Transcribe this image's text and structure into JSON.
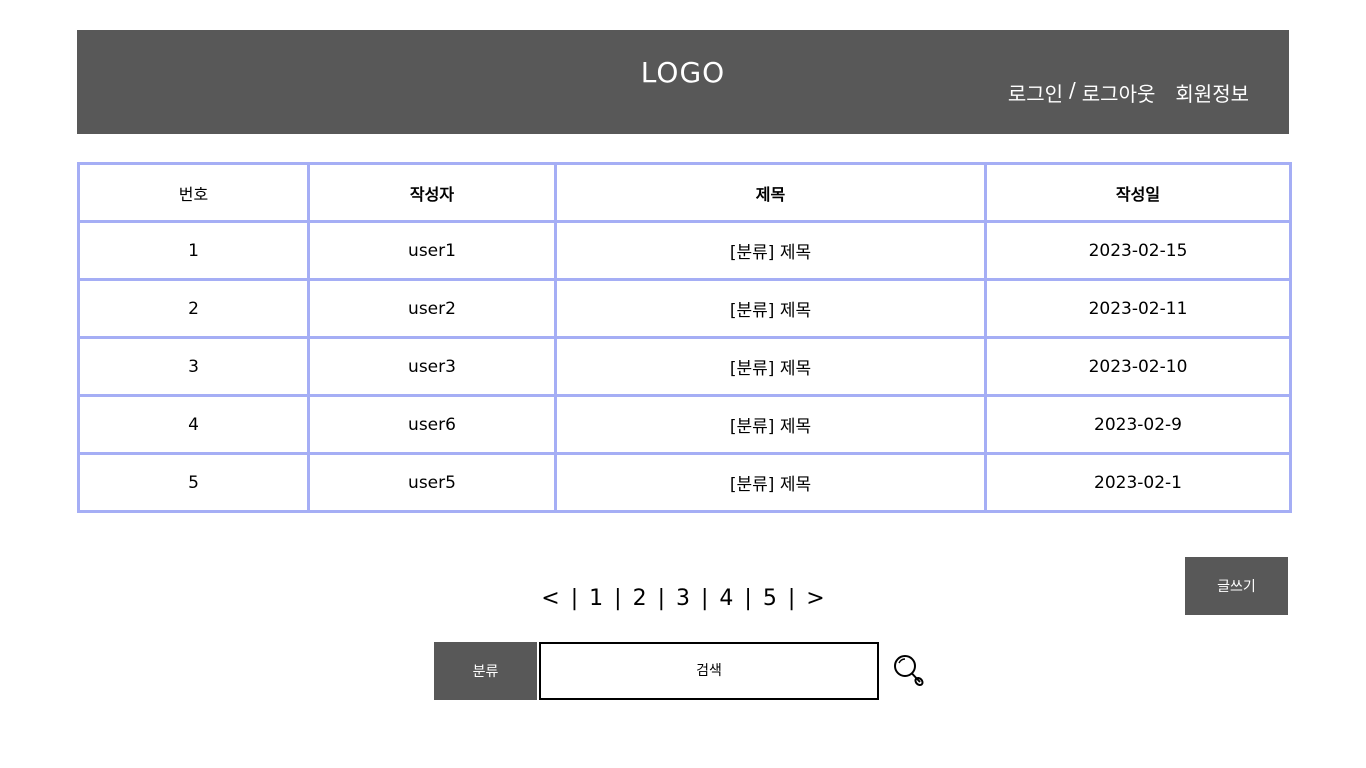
{
  "header": {
    "logo": "LOGO",
    "nav": {
      "login": "로그인",
      "separator": "/",
      "logout": "로그아웃",
      "member_info": "회원정보"
    },
    "background": "#585858"
  },
  "table": {
    "columns": [
      "번호",
      "작성자",
      "제목",
      "작성일"
    ],
    "rows": [
      {
        "no": "1",
        "author": "user1",
        "title": "[분류] 제목",
        "date": "2023-02-15"
      },
      {
        "no": "2",
        "author": "user2",
        "title": "[분류] 제목",
        "date": "2023-02-11"
      },
      {
        "no": "3",
        "author": "user3",
        "title": "[분류] 제목",
        "date": "2023-02-10"
      },
      {
        "no": "4",
        "author": "user6",
        "title": "[분류] 제목",
        "date": "2023-02-9"
      },
      {
        "no": "5",
        "author": "user5",
        "title": "[분류] 제목",
        "date": "2023-02-1"
      }
    ],
    "border_color": "#a5aef5"
  },
  "write_button": "글쓰기",
  "pagination": {
    "prev": "<",
    "next": ">",
    "separator": "|",
    "pages": [
      "1",
      "2",
      "3",
      "4",
      "5"
    ]
  },
  "search": {
    "category_label": "분류",
    "input_text": "검색",
    "icon": "search-icon"
  }
}
